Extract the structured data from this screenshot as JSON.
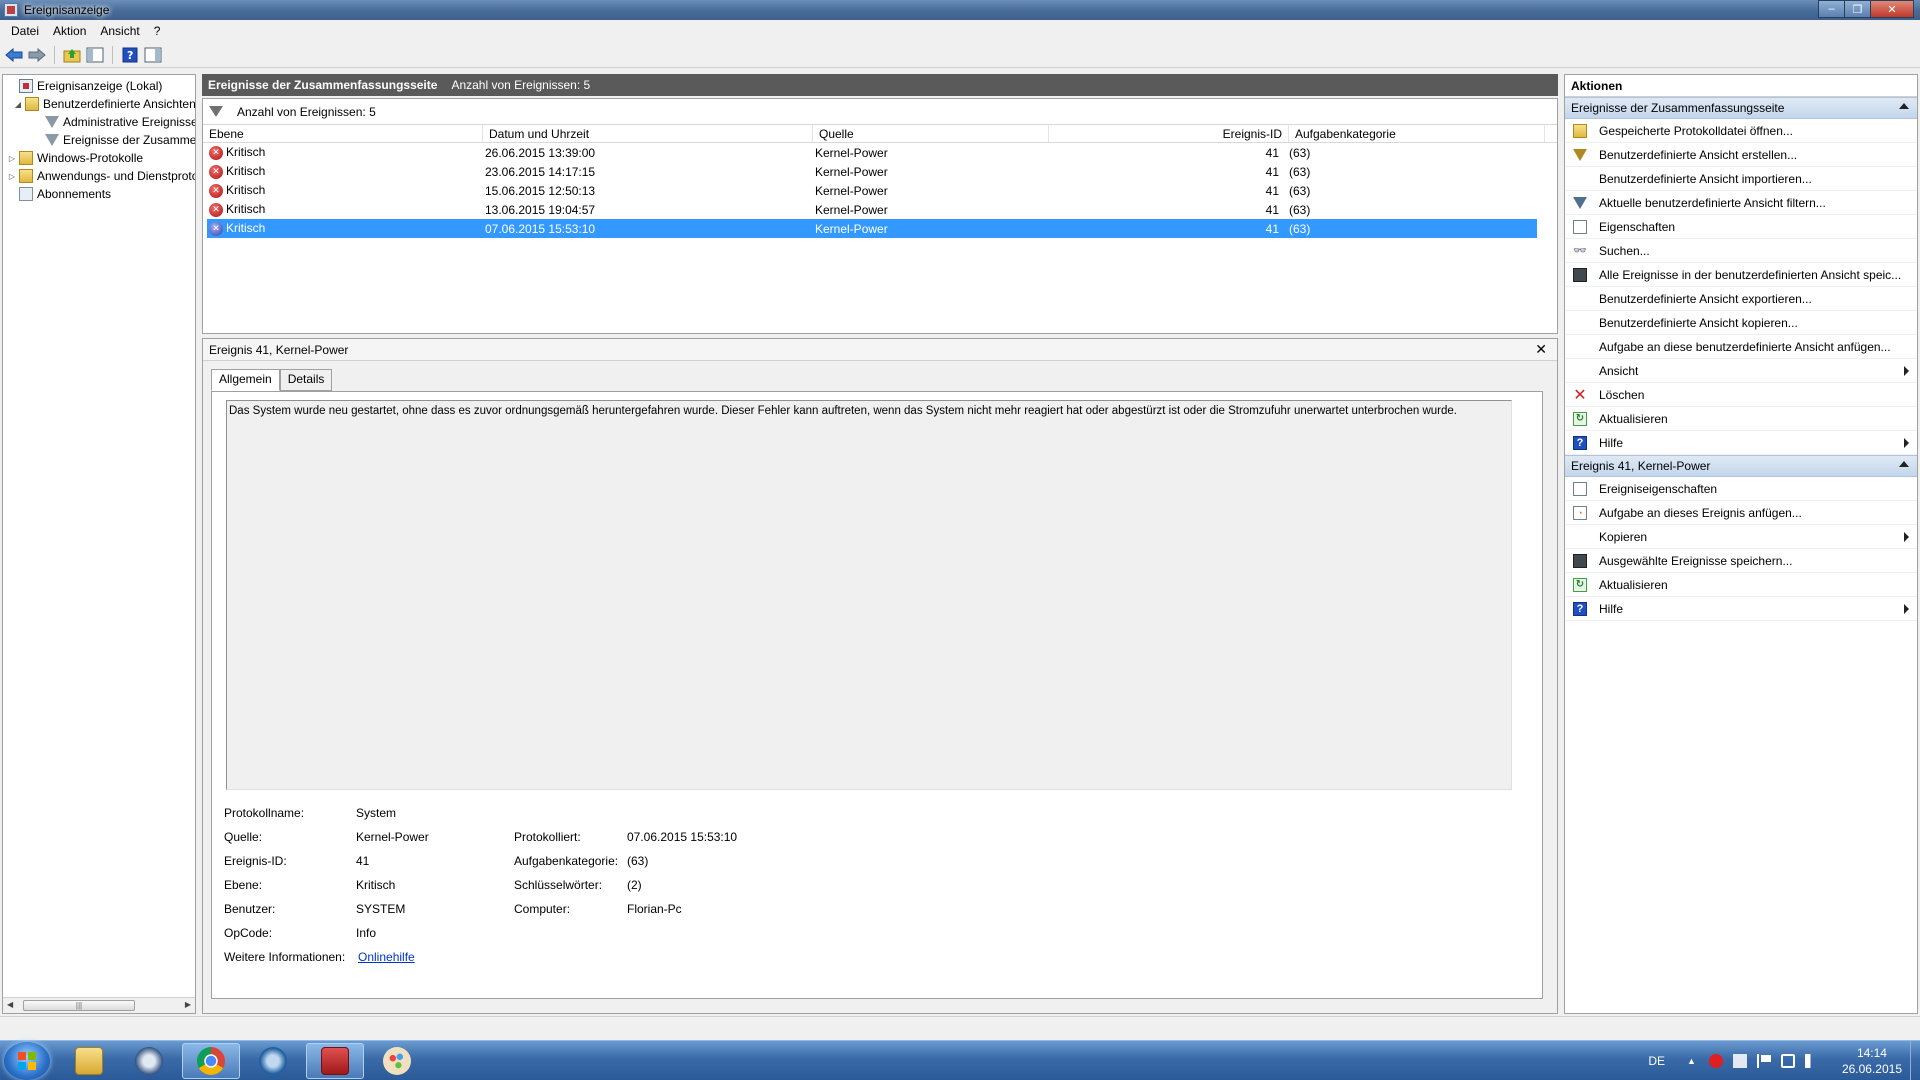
{
  "window": {
    "title": "Ereignisanzeige",
    "controls": [
      "minimize",
      "maximize",
      "close"
    ]
  },
  "menu": [
    "Datei",
    "Aktion",
    "Ansicht",
    "?"
  ],
  "toolbar": [
    "back-icon",
    "forward-icon",
    "up-folder-icon",
    "show-hide-tree-icon",
    "help-icon",
    "show-hide-action-pane-icon"
  ],
  "tree": {
    "items": [
      {
        "label": "Ereignisanzeige (Lokal)",
        "icon": "event-viewer-icon",
        "expander": ""
      },
      {
        "label": "Benutzerdefinierte Ansichten",
        "icon": "folder-icon",
        "expander": "◢"
      },
      {
        "label": "Administrative Ereignisse",
        "icon": "filter-icon",
        "expander": ""
      },
      {
        "label": "Ereignisse der Zusammenfassungsseite",
        "icon": "filter-icon",
        "expander": ""
      },
      {
        "label": "Windows-Protokolle",
        "icon": "folder-icon",
        "expander": "▷"
      },
      {
        "label": "Anwendungs- und Dienstprotokolle",
        "icon": "folder-icon",
        "expander": "▷"
      },
      {
        "label": "Abonnements",
        "icon": "subscriptions-icon",
        "expander": ""
      }
    ]
  },
  "center": {
    "header_title": "Ereignisse der Zusammenfassungsseite",
    "header_count": "Anzahl von Ereignissen: 5",
    "filter_text": "Anzahl von Ereignissen: 5",
    "columns": [
      "Ebene",
      "Datum und Uhrzeit",
      "Quelle",
      "Ereignis-ID",
      "Aufgabenkategorie"
    ],
    "rows": [
      {
        "level": "Kritisch",
        "datetime": "26.06.2015 13:39:00",
        "source": "Kernel-Power",
        "id": "41",
        "category": "(63)"
      },
      {
        "level": "Kritisch",
        "datetime": "23.06.2015 14:17:15",
        "source": "Kernel-Power",
        "id": "41",
        "category": "(63)"
      },
      {
        "level": "Kritisch",
        "datetime": "15.06.2015 12:50:13",
        "source": "Kernel-Power",
        "id": "41",
        "category": "(63)"
      },
      {
        "level": "Kritisch",
        "datetime": "13.06.2015 19:04:57",
        "source": "Kernel-Power",
        "id": "41",
        "category": "(63)"
      },
      {
        "level": "Kritisch",
        "datetime": "07.06.2015 15:53:10",
        "source": "Kernel-Power",
        "id": "41",
        "category": "(63)"
      }
    ],
    "selected_row": 4
  },
  "detail": {
    "title": "Ereignis 41, Kernel-Power",
    "close": "✕",
    "tabs": [
      "Allgemein",
      "Details"
    ],
    "description": "Das System wurde neu gestartet, ohne dass es zuvor ordnungsgemäß heruntergefahren wurde. Dieser Fehler kann auftreten, wenn das System nicht mehr reagiert hat oder abgestürzt ist oder die Stromzufuhr unerwartet unterbrochen wurde.",
    "props": {
      "protokollname_label": "Protokollname:",
      "protokollname": "System",
      "quelle_label": "Quelle:",
      "quelle": "Kernel-Power",
      "protokolliert_label": "Protokolliert:",
      "protokolliert": "07.06.2015 15:53:10",
      "id_label": "Ereignis-ID:",
      "id": "41",
      "aufgabe_label": "Aufgabenkategorie:",
      "aufgabe": "(63)",
      "ebene_label": "Ebene:",
      "ebene": "Kritisch",
      "schluessel_label": "Schlüsselwörter:",
      "schluessel": "(2)",
      "benutzer_label": "Benutzer:",
      "benutzer": "SYSTEM",
      "computer_label": "Computer:",
      "computer": "Florian-Pc",
      "opcode_label": "OpCode:",
      "opcode": "Info",
      "weitere_label": "Weitere Informationen:",
      "weitere_link": "Onlinehilfe"
    }
  },
  "actions": {
    "title": "Aktionen",
    "group1_title": "Ereignisse der Zusammenfassungsseite",
    "group1": [
      {
        "label": "Gespeicherte Protokolldatei öffnen...",
        "icon": "open-log-icon",
        "sub": false
      },
      {
        "label": "Benutzerdefinierte Ansicht erstellen...",
        "icon": "create-view-icon",
        "sub": false
      },
      {
        "label": "Benutzerdefinierte Ansicht importieren...",
        "icon": "",
        "sub": false
      },
      {
        "label": "Aktuelle benutzerdefinierte Ansicht filtern...",
        "icon": "filter-icon",
        "sub": false
      },
      {
        "label": "Eigenschaften",
        "icon": "properties-icon",
        "sub": false
      },
      {
        "label": "Suchen...",
        "icon": "binoculars-icon",
        "sub": false
      },
      {
        "label": "Alle Ereignisse in der benutzerdefinierten Ansicht speic...",
        "icon": "save-icon",
        "sub": false
      },
      {
        "label": "Benutzerdefinierte Ansicht exportieren...",
        "icon": "",
        "sub": false
      },
      {
        "label": "Benutzerdefinierte Ansicht kopieren...",
        "icon": "",
        "sub": false
      },
      {
        "label": "Aufgabe an diese benutzerdefinierte Ansicht anfügen...",
        "icon": "",
        "sub": false
      },
      {
        "label": "Ansicht",
        "icon": "",
        "sub": true
      },
      {
        "label": "Löschen",
        "icon": "delete-icon",
        "sub": false
      },
      {
        "label": "Aktualisieren",
        "icon": "refresh-icon",
        "sub": false
      },
      {
        "label": "Hilfe",
        "icon": "help-icon",
        "sub": true
      }
    ],
    "group2_title": "Ereignis 41, Kernel-Power",
    "group2": [
      {
        "label": "Ereigniseigenschaften",
        "icon": "properties-icon",
        "sub": false
      },
      {
        "label": "Aufgabe an dieses Ereignis anfügen...",
        "icon": "task-icon",
        "sub": false
      },
      {
        "label": "Kopieren",
        "icon": "",
        "sub": true
      },
      {
        "label": "Ausgewählte Ereignisse speichern...",
        "icon": "save-icon",
        "sub": false
      },
      {
        "label": "Aktualisieren",
        "icon": "refresh-icon",
        "sub": false
      },
      {
        "label": "Hilfe",
        "icon": "help-icon",
        "sub": true
      }
    ]
  },
  "taskbar": {
    "apps": [
      "explorer-icon",
      "thunderbird-icon",
      "chrome-icon",
      "teamspeak-icon",
      "toolbox-icon",
      "paint-icon"
    ],
    "active_app": 4,
    "language": "DE",
    "time": "14:14",
    "date": "26.06.2015"
  }
}
